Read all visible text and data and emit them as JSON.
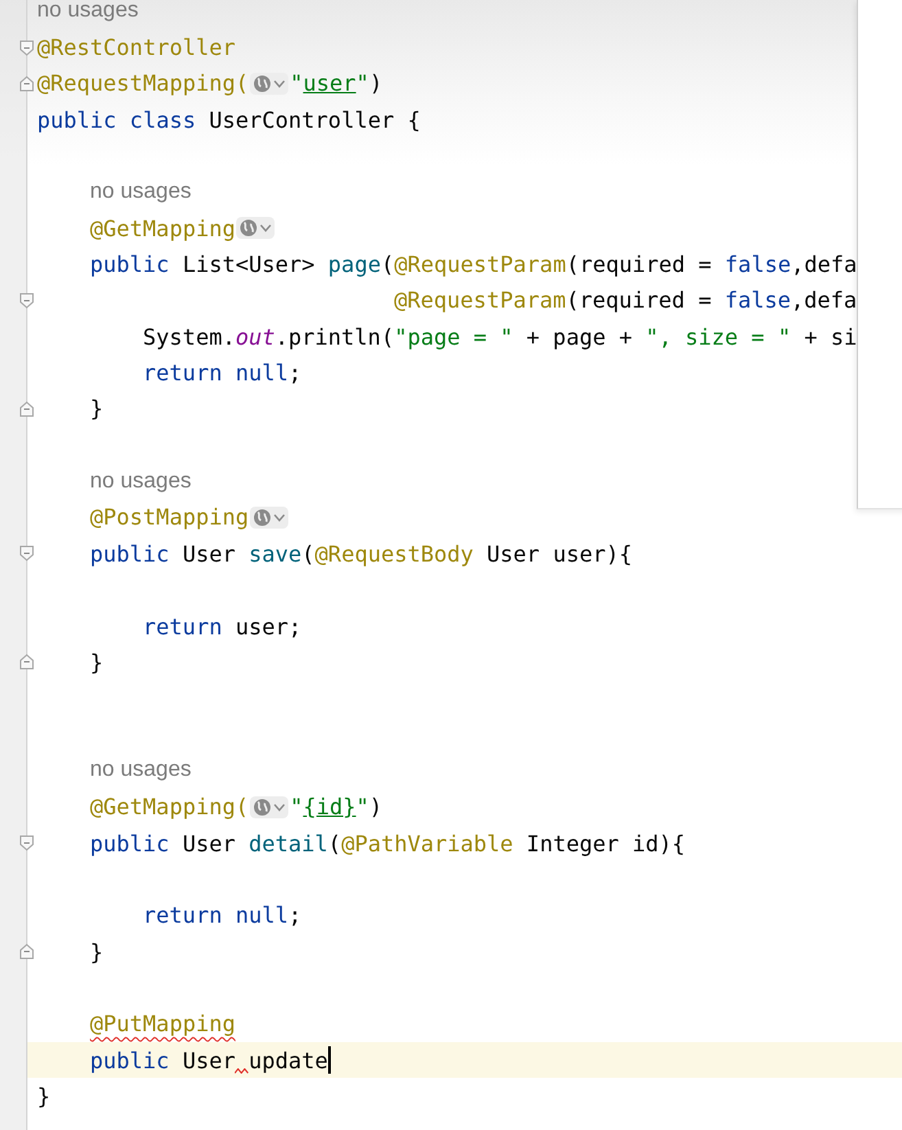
{
  "editor": {
    "lines": [
      {
        "kind": "hint",
        "text": "no usages"
      },
      {
        "kind": "code",
        "fold_open": true,
        "tokens": [
          {
            "kind": "ann",
            "text": "@RestController"
          }
        ]
      },
      {
        "kind": "code",
        "fold_close": true,
        "tokens": [
          {
            "kind": "ann",
            "text": "@RequestMapping("
          },
          {
            "kind": "inlay"
          },
          {
            "kind": "str",
            "text": "\""
          },
          {
            "kind": "link",
            "text": "user"
          },
          {
            "kind": "str",
            "text": "\""
          },
          {
            "kind": "plain",
            "text": ")"
          }
        ]
      },
      {
        "kind": "code",
        "tokens": [
          {
            "kind": "kw",
            "text": "public class "
          },
          {
            "kind": "plain",
            "text": "UserController {"
          }
        ],
        "children": [
          {
            "kind": "blank"
          },
          {
            "kind": "hint",
            "text": "no usages"
          },
          {
            "kind": "code",
            "tokens": [
              {
                "kind": "ann",
                "text": "@GetMapping"
              },
              {
                "kind": "inlay"
              }
            ]
          },
          {
            "kind": "code",
            "tokens": [
              {
                "kind": "kw",
                "text": "public "
              },
              {
                "kind": "plain",
                "text": "List<User> "
              },
              {
                "kind": "fn",
                "text": "page"
              },
              {
                "kind": "plain",
                "text": "("
              },
              {
                "kind": "ann",
                "text": "@RequestParam"
              },
              {
                "kind": "plain",
                "text": "(required = "
              },
              {
                "kind": "kw",
                "text": "false"
              },
              {
                "kind": "plain",
                "text": ",defa"
              }
            ],
            "children": [
              {
                "kind": "code",
                "continuation": true,
                "fold_open": true,
                "tokens": [
                  {
                    "kind": "ann",
                    "text": "@RequestParam"
                  },
                  {
                    "kind": "plain",
                    "text": "(required = "
                  },
                  {
                    "kind": "kw",
                    "text": "false"
                  },
                  {
                    "kind": "plain",
                    "text": ",defa"
                  }
                ]
              },
              {
                "kind": "code",
                "tokens": [
                  {
                    "kind": "plain",
                    "text": "System."
                  },
                  {
                    "kind": "field",
                    "text": "out"
                  },
                  {
                    "kind": "plain",
                    "text": ".println("
                  },
                  {
                    "kind": "str",
                    "text": "\"page = \""
                  },
                  {
                    "kind": "plain",
                    "text": " + page + "
                  },
                  {
                    "kind": "str",
                    "text": "\", size = \""
                  },
                  {
                    "kind": "plain",
                    "text": " + si"
                  }
                ]
              },
              {
                "kind": "code",
                "tokens": [
                  {
                    "kind": "kw",
                    "text": "return null"
                  },
                  {
                    "kind": "plain",
                    "text": ";"
                  }
                ]
              }
            ]
          },
          {
            "kind": "code",
            "fold_close": true,
            "tokens": [
              {
                "kind": "plain",
                "text": "}"
              }
            ]
          },
          {
            "kind": "blank"
          },
          {
            "kind": "hint",
            "text": "no usages"
          },
          {
            "kind": "code",
            "tokens": [
              {
                "kind": "ann",
                "text": "@PostMapping"
              },
              {
                "kind": "inlay"
              }
            ]
          },
          {
            "kind": "code",
            "fold_open": true,
            "tokens": [
              {
                "kind": "kw",
                "text": "public "
              },
              {
                "kind": "plain",
                "text": "User "
              },
              {
                "kind": "fn",
                "text": "save"
              },
              {
                "kind": "plain",
                "text": "("
              },
              {
                "kind": "ann",
                "text": "@RequestBody"
              },
              {
                "kind": "plain",
                "text": " User user){"
              }
            ],
            "children": [
              {
                "kind": "blank"
              },
              {
                "kind": "code",
                "tokens": [
                  {
                    "kind": "kw",
                    "text": "return "
                  },
                  {
                    "kind": "plain",
                    "text": "user;"
                  }
                ]
              }
            ]
          },
          {
            "kind": "code",
            "fold_close": true,
            "tokens": [
              {
                "kind": "plain",
                "text": "}"
              }
            ]
          },
          {
            "kind": "blank"
          },
          {
            "kind": "blank"
          },
          {
            "kind": "hint",
            "text": "no usages"
          },
          {
            "kind": "code",
            "tokens": [
              {
                "kind": "ann",
                "text": "@GetMapping("
              },
              {
                "kind": "inlay"
              },
              {
                "kind": "str",
                "text": "\""
              },
              {
                "kind": "link",
                "text": "{id}"
              },
              {
                "kind": "str",
                "text": "\""
              },
              {
                "kind": "plain",
                "text": ")"
              }
            ]
          },
          {
            "kind": "code",
            "fold_open": true,
            "tokens": [
              {
                "kind": "kw",
                "text": "public "
              },
              {
                "kind": "plain",
                "text": "User "
              },
              {
                "kind": "fn",
                "text": "detail"
              },
              {
                "kind": "plain",
                "text": "("
              },
              {
                "kind": "ann",
                "text": "@PathVariable"
              },
              {
                "kind": "plain",
                "text": " Integer id){"
              }
            ],
            "children": [
              {
                "kind": "blank"
              },
              {
                "kind": "code",
                "tokens": [
                  {
                    "kind": "kw",
                    "text": "return null"
                  },
                  {
                    "kind": "plain",
                    "text": ";"
                  }
                ]
              }
            ]
          },
          {
            "kind": "code",
            "fold_close": true,
            "tokens": [
              {
                "kind": "plain",
                "text": "}"
              }
            ]
          },
          {
            "kind": "blank"
          },
          {
            "kind": "code",
            "tokens": [
              {
                "kind": "ann",
                "text": "@PutMapping",
                "error": true
              }
            ]
          },
          {
            "kind": "code",
            "current": true,
            "tokens": [
              {
                "kind": "kw",
                "text": "public "
              },
              {
                "kind": "plain",
                "text": "User"
              },
              {
                "kind": "squiggle"
              },
              {
                "kind": "plain",
                "text": "update"
              },
              {
                "kind": "caret"
              }
            ]
          }
        ]
      },
      {
        "kind": "code",
        "tokens": [
          {
            "kind": "plain",
            "text": "}"
          }
        ]
      }
    ]
  },
  "side_panel": {
    "visible": true
  }
}
